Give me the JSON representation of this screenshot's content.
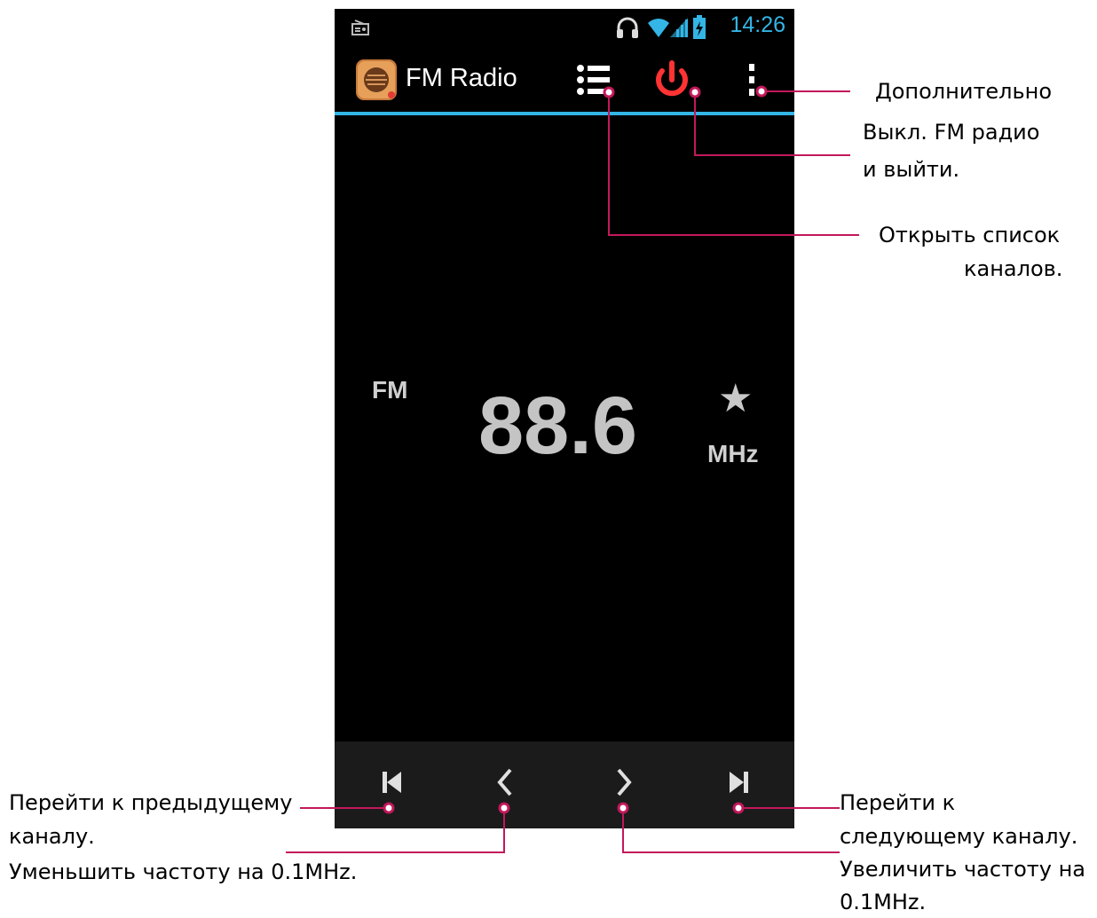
{
  "status_bar": {
    "time": "14:26"
  },
  "app": {
    "title": "FM Radio"
  },
  "tuner": {
    "band": "FM",
    "frequency": "88.6",
    "unit": "MHz"
  },
  "icons": [
    "radio-icon",
    "headset-icon",
    "wifi-icon",
    "signal-icon",
    "battery-icon",
    "list-icon",
    "power-icon",
    "overflow-menu-icon",
    "star-icon",
    "skip-previous-icon",
    "chevron-left-icon",
    "chevron-right-icon",
    "skip-next-icon"
  ],
  "colors": {
    "accent": "#33b5e5",
    "power": "#ff3333",
    "callout": "#c2185b"
  },
  "annotations": {
    "more": "Дополнительно",
    "power_1": "Выкл. FM радио",
    "power_2": "и выйти.",
    "list_1": "Открыть список",
    "list_2": "каналов.",
    "prev_1": "Перейти к предыдущему",
    "prev_2": "каналу.",
    "decrease": "Уменьшить частоту на 0.1MHz.",
    "next_1": "Перейти к",
    "next_2": "следующему каналу.",
    "increase_1": "Увеличить частоту на",
    "increase_2": "0.1MHz."
  }
}
